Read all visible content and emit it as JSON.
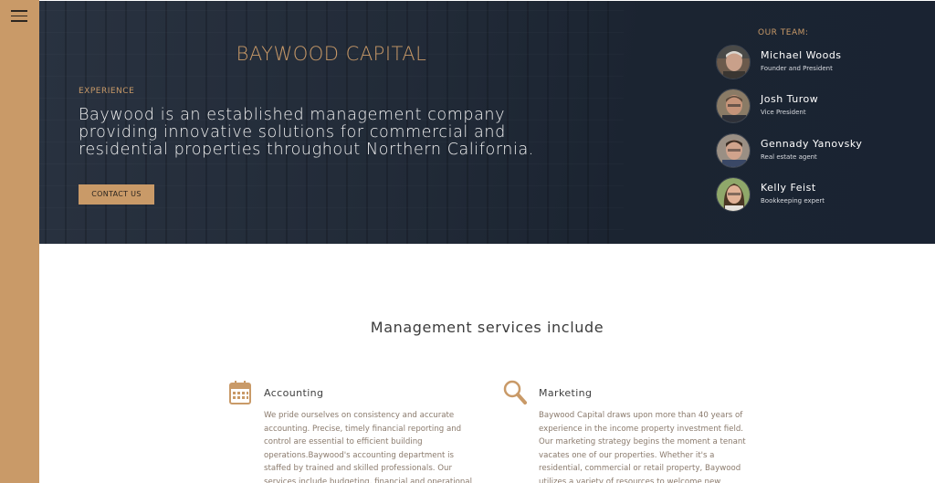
{
  "hero": {
    "company_name": "BAYWOOD CAPITAL",
    "experience_label": "EXPERIENCE",
    "tagline": "Baywood is an established management company providing innovative solutions for commercial and residential properties throughout Northern California.",
    "contact_button": "CONTACT US"
  },
  "team": {
    "title": "OUR TEAM:",
    "members": [
      {
        "name": "Michael Woods",
        "role": "Founder and President"
      },
      {
        "name": "Josh Turow",
        "role": "Vice President"
      },
      {
        "name": "Gennady Yanovsky",
        "role": "Real estate agent"
      },
      {
        "name": "Kelly Feist",
        "role": "Bookkeeping expert"
      }
    ]
  },
  "services": {
    "title": "Management services include",
    "items": [
      {
        "icon": "calendar-icon",
        "title": "Accounting",
        "text": "We pride ourselves on consistency and accurate accounting. Precise, timely financial reporting and control are essential to efficient building operations.Baywood's accounting department is staffed by trained and skilled professionals. Our services include budgeting, financial and operational reporting, monitoring and control of"
      },
      {
        "icon": "magnifier-icon",
        "title": "Marketing",
        "text": "Baywood Capital draws upon more than 40 years of experience in the income property investment field. Our marketing strategy begins the moment a tenant vacates one of our properties. Whether it's a residential, commercial or retail property, Baywood utilizes a variety of resources to welcome new tenants to our properties."
      }
    ]
  },
  "colors": {
    "accent": "#c99a68",
    "hero_bg": "#1e2735",
    "text_muted": "#8a7a6c"
  }
}
